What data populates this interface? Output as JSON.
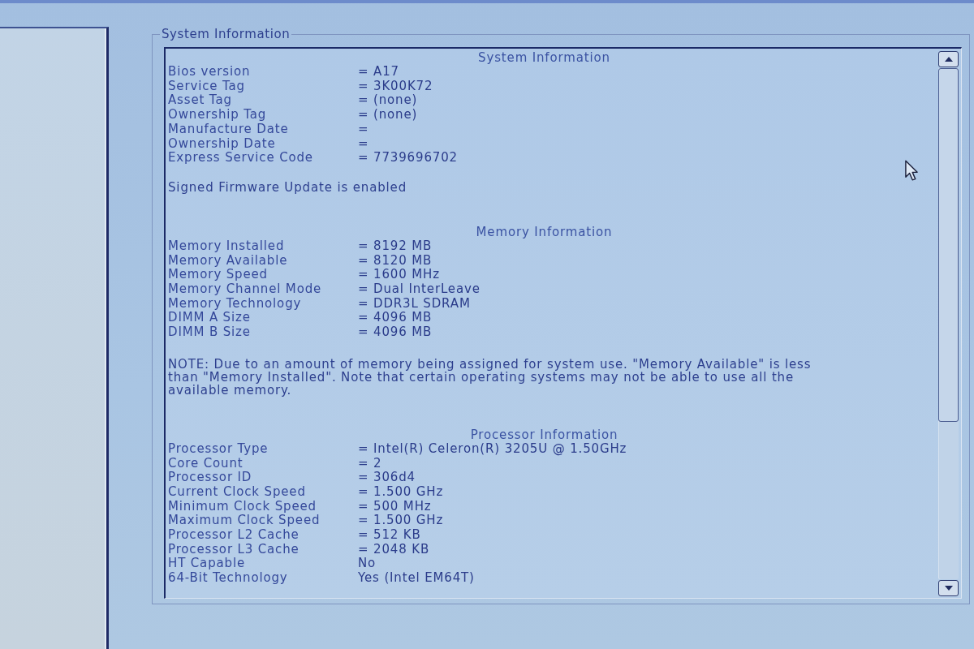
{
  "group_box": {
    "title": "System Information"
  },
  "sections": [
    {
      "heading": "System Information",
      "rows": [
        {
          "label": "Bios version",
          "value": "= A17"
        },
        {
          "label": "Service Tag",
          "value": "= 3K00K72"
        },
        {
          "label": "Asset Tag",
          "value": "= (none)"
        },
        {
          "label": "Ownership Tag",
          "value": "= (none)"
        },
        {
          "label": "Manufacture Date",
          "value": "="
        },
        {
          "label": "Ownership Date",
          "value": "="
        },
        {
          "label": "Express Service Code",
          "value": "= 7739696702"
        }
      ],
      "note": "Signed Firmware Update is enabled"
    },
    {
      "heading": "Memory Information",
      "rows": [
        {
          "label": "Memory Installed",
          "value": "= 8192 MB"
        },
        {
          "label": "Memory Available",
          "value": "= 8120 MB"
        },
        {
          "label": "Memory Speed",
          "value": "= 1600 MHz"
        },
        {
          "label": "Memory Channel Mode",
          "value": "= Dual InterLeave"
        },
        {
          "label": "Memory Technology",
          "value": "= DDR3L SDRAM"
        },
        {
          "label": "DIMM A Size",
          "value": "= 4096 MB"
        },
        {
          "label": "DIMM B Size",
          "value": "= 4096 MB"
        }
      ],
      "note": "NOTE: Due to an amount of memory being assigned for system use. \"Memory Available\" is less than \"Memory Installed\". Note that certain operating systems may not be able to use all the available memory."
    },
    {
      "heading": "Processor Information",
      "rows": [
        {
          "label": "Processor Type",
          "value": "= Intel(R) Celeron(R) 3205U @ 1.50GHz"
        },
        {
          "label": "Core Count",
          "value": "= 2"
        },
        {
          "label": "Processor ID",
          "value": "= 306d4"
        },
        {
          "label": "Current Clock Speed",
          "value": "= 1.500 GHz"
        },
        {
          "label": "Minimum Clock Speed",
          "value": "= 500 MHz"
        },
        {
          "label": "Maximum Clock Speed",
          "value": "= 1.500 GHz"
        },
        {
          "label": "Processor L2 Cache",
          "value": "= 512 KB"
        },
        {
          "label": "Processor L3 Cache",
          "value": "= 2048 KB"
        },
        {
          "label": "HT Capable",
          "value": "No"
        },
        {
          "label": "64-Bit Technology",
          "value": "Yes (Intel EM64T)"
        }
      ]
    }
  ]
}
